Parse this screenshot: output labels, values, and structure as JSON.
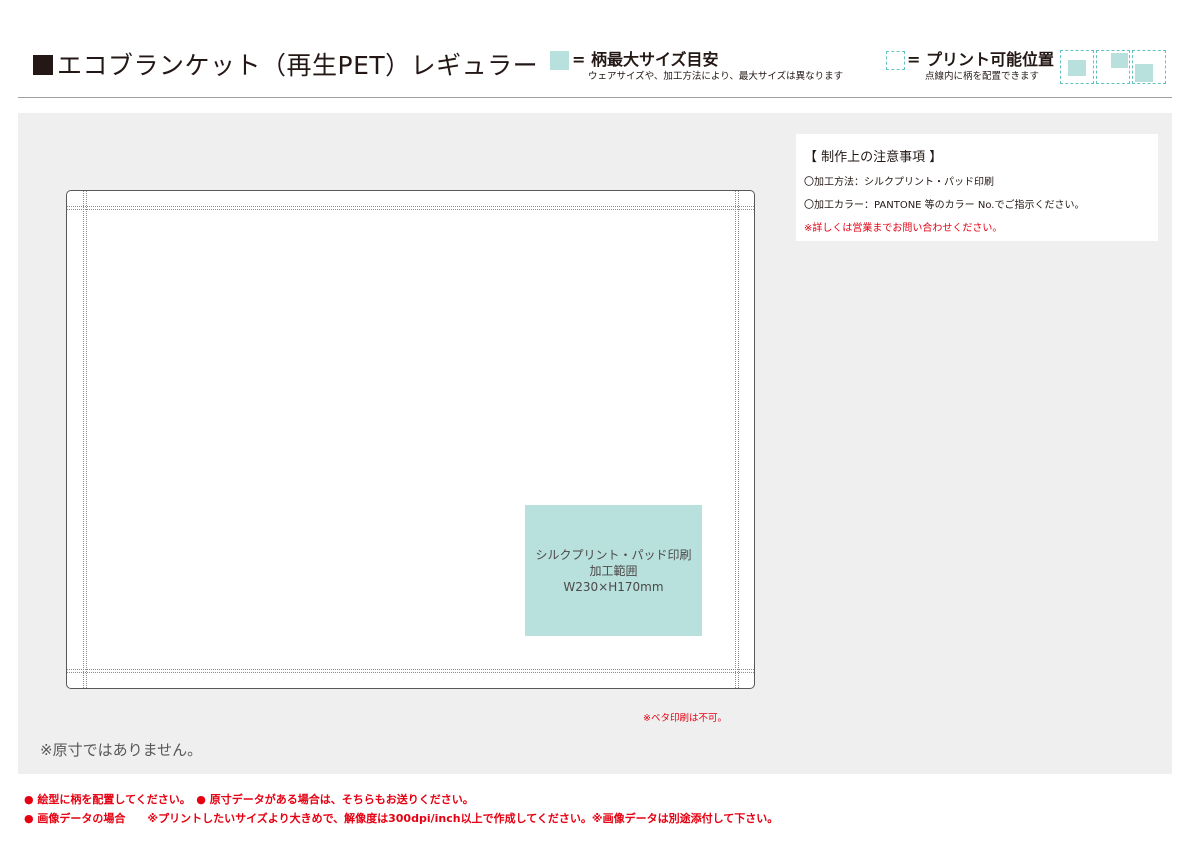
{
  "header": {
    "title": "エコブランケット（再生PET）レギュラー",
    "legend_pattern": {
      "label": "= 柄最大サイズ目安",
      "note": "ウェアサイズや、加工方法により、最大サイズは異なります"
    },
    "legend_print": {
      "label": "= プリント可能位置",
      "note": "点線内に柄を配置できます"
    }
  },
  "print_area": {
    "line1": "シルクプリント・パッド印刷",
    "line2": "加工範囲",
    "line3": "W230×H170mm"
  },
  "notes": {
    "title": "【 制作上の注意事項 】",
    "method": "〇加工方法：シルクプリント・パッド印刷",
    "color": "〇加工カラー：PANTONE 等のカラー No.でご指示ください。",
    "contact": "※詳しくは営業までお問い合わせください。"
  },
  "beta_note": "※ベタ印刷は不可。",
  "not_actual_size": "※原寸ではありません。",
  "footer": {
    "line1": "● 絵型に柄を配置してください。　● 原寸データがある場合は、そちらもお送りください。",
    "line2": "● 画像データの場合　　※プリントしたいサイズより大きめで、解像度は300dpi/inch以上で作成してください。※画像データは別途添付して下さい。"
  },
  "colors": {
    "print_area": "#b8e0dd",
    "dashed": "#64c3c0",
    "panel": "#efefef",
    "warning": "#e60012"
  }
}
